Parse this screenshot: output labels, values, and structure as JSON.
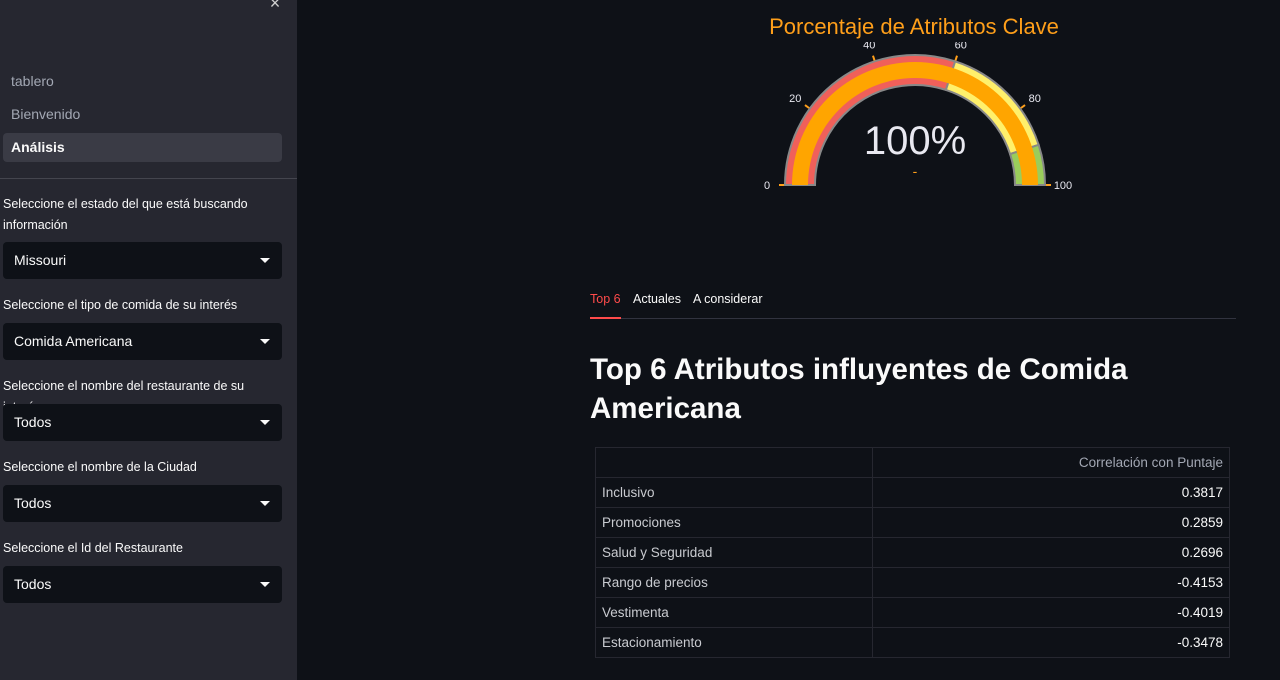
{
  "sidebar": {
    "close_glyph": "×",
    "nav": [
      {
        "label": "tablero",
        "active": false
      },
      {
        "label": "Bienvenido",
        "active": false
      },
      {
        "label": "Análisis",
        "active": true
      }
    ],
    "fields": [
      {
        "label": "Seleccione el estado del que está buscando información",
        "value": "Missouri"
      },
      {
        "label": "Seleccione el tipo de comida de su interés",
        "value": "Comida Americana"
      },
      {
        "label": "Seleccione el nombre del restaurante de su interés",
        "value": "Todos"
      },
      {
        "label": "Seleccione el nombre de la Ciudad",
        "value": "Todos"
      },
      {
        "label": "Seleccione el Id del Restaurante",
        "value": "Todos"
      }
    ]
  },
  "gauge": {
    "title": "Porcentaje de Atributos Clave",
    "value_text": "100%",
    "delta_text": "-",
    "value": 100,
    "range": [
      0,
      100
    ],
    "ticks": [
      "0",
      "20",
      "40",
      "60",
      "80",
      "100"
    ],
    "colors": {
      "title": "#ff9f1a",
      "bar": "#ffa500",
      "red": "#f0605a",
      "yellow": "#fff06b",
      "green": "#9acd5b"
    }
  },
  "tabs": [
    {
      "label": "Top 6",
      "active": true
    },
    {
      "label": "Actuales",
      "active": false
    },
    {
      "label": "A considerar",
      "active": false
    }
  ],
  "heading": "Top 6 Atributos influyentes de Comida Americana",
  "table": {
    "header": [
      "",
      "Correlación con Puntaje"
    ],
    "rows": [
      {
        "label": "Inclusivo",
        "value": "0.3817"
      },
      {
        "label": "Promociones",
        "value": "0.2859"
      },
      {
        "label": "Salud y Seguridad",
        "value": "0.2696"
      },
      {
        "label": "Rango de precios",
        "value": "-0.4153"
      },
      {
        "label": "Vestimenta",
        "value": "-0.4019"
      },
      {
        "label": "Estacionamiento",
        "value": "-0.3478"
      }
    ]
  }
}
